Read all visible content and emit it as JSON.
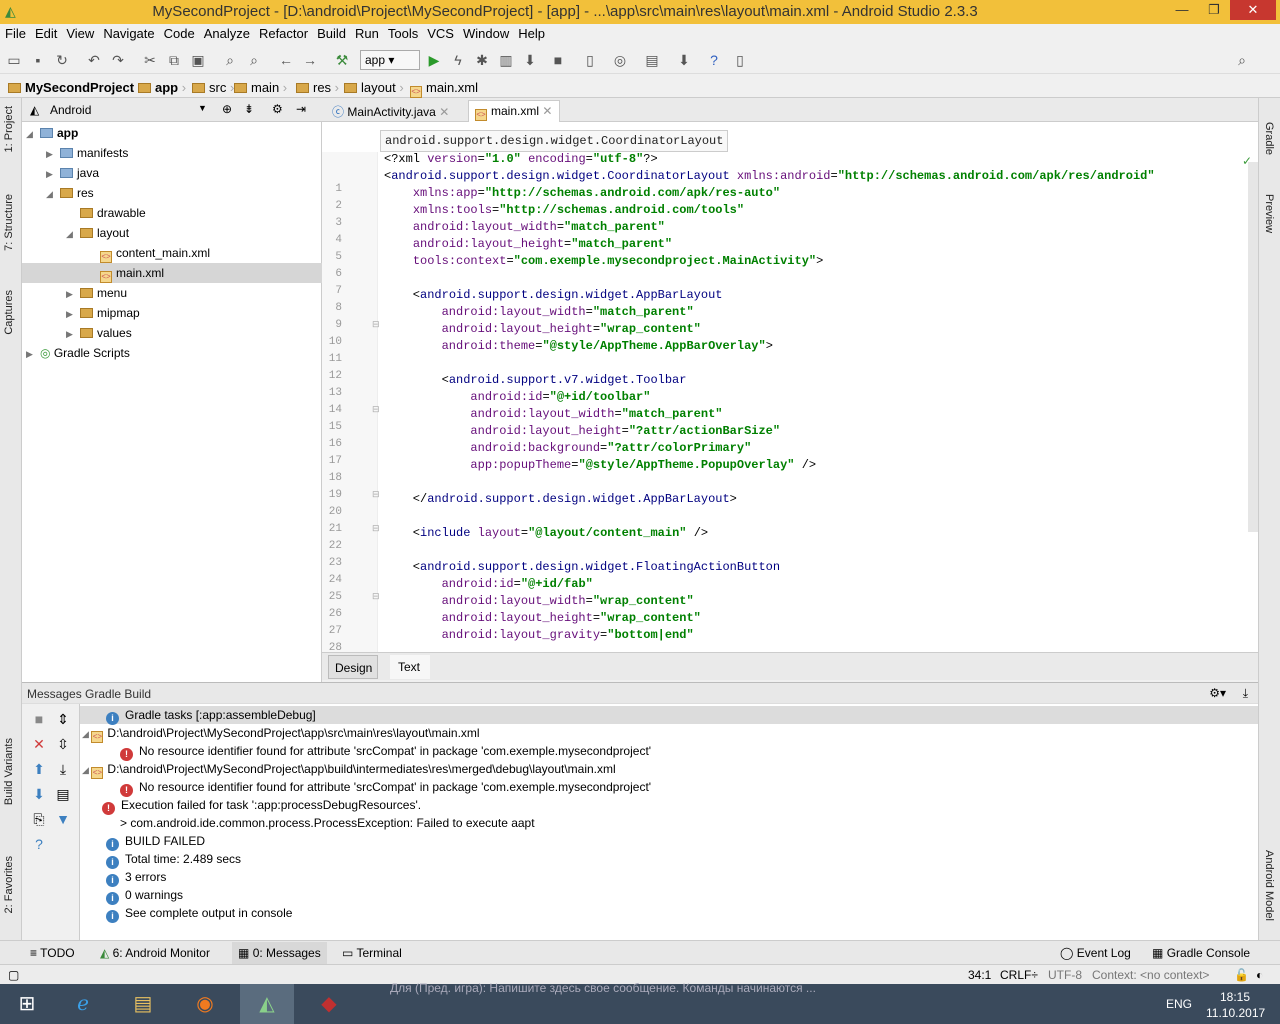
{
  "window": {
    "title": "MySecondProject - [D:\\android\\Project\\MySecondProject] - [app] - ...\\app\\src\\main\\res\\layout\\main.xml - Android Studio 2.3.3"
  },
  "menu": [
    "File",
    "Edit",
    "View",
    "Navigate",
    "Code",
    "Analyze",
    "Refactor",
    "Build",
    "Run",
    "Tools",
    "VCS",
    "Window",
    "Help"
  ],
  "run_config": "app",
  "breadcrumb": [
    "MySecondProject",
    "app",
    "src",
    "main",
    "res",
    "layout",
    "main.xml"
  ],
  "left_tabs": [
    "1: Project",
    "7: Structure",
    "Captures",
    "Build Variants",
    "2: Favorites"
  ],
  "right_tabs": [
    "Gradle",
    "Preview",
    "Android Model"
  ],
  "project_view": "Android",
  "tree": [
    {
      "label": "app",
      "bold": true
    },
    {
      "label": "manifests"
    },
    {
      "label": "java"
    },
    {
      "label": "res"
    },
    {
      "label": "drawable"
    },
    {
      "label": "layout"
    },
    {
      "label": "content_main.xml"
    },
    {
      "label": "main.xml"
    },
    {
      "label": "menu"
    },
    {
      "label": "mipmap"
    },
    {
      "label": "values"
    },
    {
      "label": "Gradle Scripts"
    }
  ],
  "editor_tabs": [
    "MainActivity.java",
    "main.xml"
  ],
  "tooltip": "android.support.design.widget.CoordinatorLayout",
  "code_lines": [
    "<?xml version=\"1.0\" encoding=\"utf-8\"?>",
    "<android.support.design.widget.CoordinatorLayout xmlns:android=\"http://schemas.android.com/apk/res/android\"",
    "    xmlns:app=\"http://schemas.android.com/apk/res-auto\"",
    "    xmlns:tools=\"http://schemas.android.com/tools\"",
    "    android:layout_width=\"match_parent\"",
    "    android:layout_height=\"match_parent\"",
    "    tools:context=\"com.exemple.mysecondproject.MainActivity\">",
    "",
    "    <android.support.design.widget.AppBarLayout",
    "        android:layout_width=\"match_parent\"",
    "        android:layout_height=\"wrap_content\"",
    "        android:theme=\"@style/AppTheme.AppBarOverlay\">",
    "",
    "        <android.support.v7.widget.Toolbar",
    "            android:id=\"@+id/toolbar\"",
    "            android:layout_width=\"match_parent\"",
    "            android:layout_height=\"?attr/actionBarSize\"",
    "            android:background=\"?attr/colorPrimary\"",
    "            app:popupTheme=\"@style/AppTheme.PopupOverlay\" />",
    "",
    "    </android.support.design.widget.AppBarLayout>",
    "",
    "    <include layout=\"@layout/content_main\" />",
    "",
    "    <android.support.design.widget.FloatingActionButton",
    "        android:id=\"@+id/fab\"",
    "        android:layout_width=\"wrap_content\"",
    "        android:layout_height=\"wrap_content\"",
    "        android:layout_gravity=\"bottom|end\""
  ],
  "design_tabs": [
    "Design",
    "Text"
  ],
  "messages_header": "Messages Gradle Build",
  "messages": [
    {
      "type": "info",
      "text": "Gradle tasks [:app:assembleDebug]"
    },
    {
      "type": "file",
      "text": "D:\\android\\Project\\MySecondProject\\app\\src\\main\\res\\layout\\main.xml"
    },
    {
      "type": "err",
      "text": "No resource identifier found for attribute 'srcCompat' in package 'com.exemple.mysecondproject'"
    },
    {
      "type": "file",
      "text": "D:\\android\\Project\\MySecondProject\\app\\build\\intermediates\\res\\merged\\debug\\layout\\main.xml"
    },
    {
      "type": "err",
      "text": "No resource identifier found for attribute 'srcCompat' in package 'com.exemple.mysecondproject'"
    },
    {
      "type": "err",
      "text": "Execution failed for task ':app:processDebugResources'."
    },
    {
      "type": "none",
      "text": "> com.android.ide.common.process.ProcessException: Failed to execute aapt"
    },
    {
      "type": "info",
      "text": "BUILD FAILED"
    },
    {
      "type": "info",
      "text": "Total time: 2.489 secs"
    },
    {
      "type": "info",
      "text": "3 errors"
    },
    {
      "type": "info",
      "text": "0 warnings"
    },
    {
      "type": "info",
      "text": "See complete output in console"
    }
  ],
  "bottom_tabs": [
    "TODO",
    "6: Android Monitor",
    "0: Messages",
    "Terminal"
  ],
  "bottom_right_tabs": [
    "Event Log",
    "Gradle Console"
  ],
  "status": {
    "position": "34:1",
    "line_sep": "CRLF÷",
    "encoding": "UTF-8",
    "context": "Context: <no context>"
  },
  "taskbar": {
    "chat": "Для (Пред. игра):   Напишите здесь свое сообщение. Команды начинаются ...",
    "lang": "ENG",
    "time": "18:15",
    "date": "11.10.2017"
  }
}
